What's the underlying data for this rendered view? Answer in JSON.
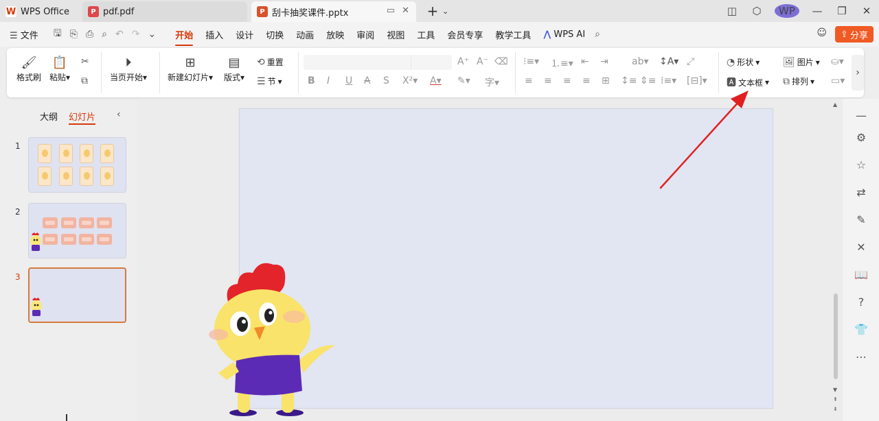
{
  "tabs": {
    "app": "WPS Office",
    "pdf": "pdf.pdf",
    "active": "刮卡抽奖课件.pptx",
    "new_tab": "+",
    "tab_menu": "⌄"
  },
  "window": {
    "avatar": "WP"
  },
  "menubar": {
    "file": "文件",
    "tabs": [
      "开始",
      "插入",
      "设计",
      "切换",
      "动画",
      "放映",
      "审阅",
      "视图",
      "工具",
      "会员专享",
      "教学工具"
    ],
    "ai": "WPS AI",
    "share": "分享"
  },
  "ribbon": {
    "format_painter": "格式刷",
    "paste": "粘贴",
    "play_from_current": "当页开始",
    "new_slide": "新建幻灯片",
    "layout": "版式",
    "reset": "重置",
    "section": "节",
    "shape": "形状",
    "picture": "图片",
    "textbox": "文本框",
    "arrange": "排列"
  },
  "left_panel": {
    "outline": "大纲",
    "slides": "幻灯片",
    "thumbs": [
      {
        "num": "1"
      },
      {
        "num": "2"
      },
      {
        "num": "3"
      }
    ]
  },
  "colors": {
    "accent": "#d7380a",
    "share_bg": "#f05a24",
    "slide_bg": "#e2e5f2",
    "arrow": "#e02020"
  }
}
